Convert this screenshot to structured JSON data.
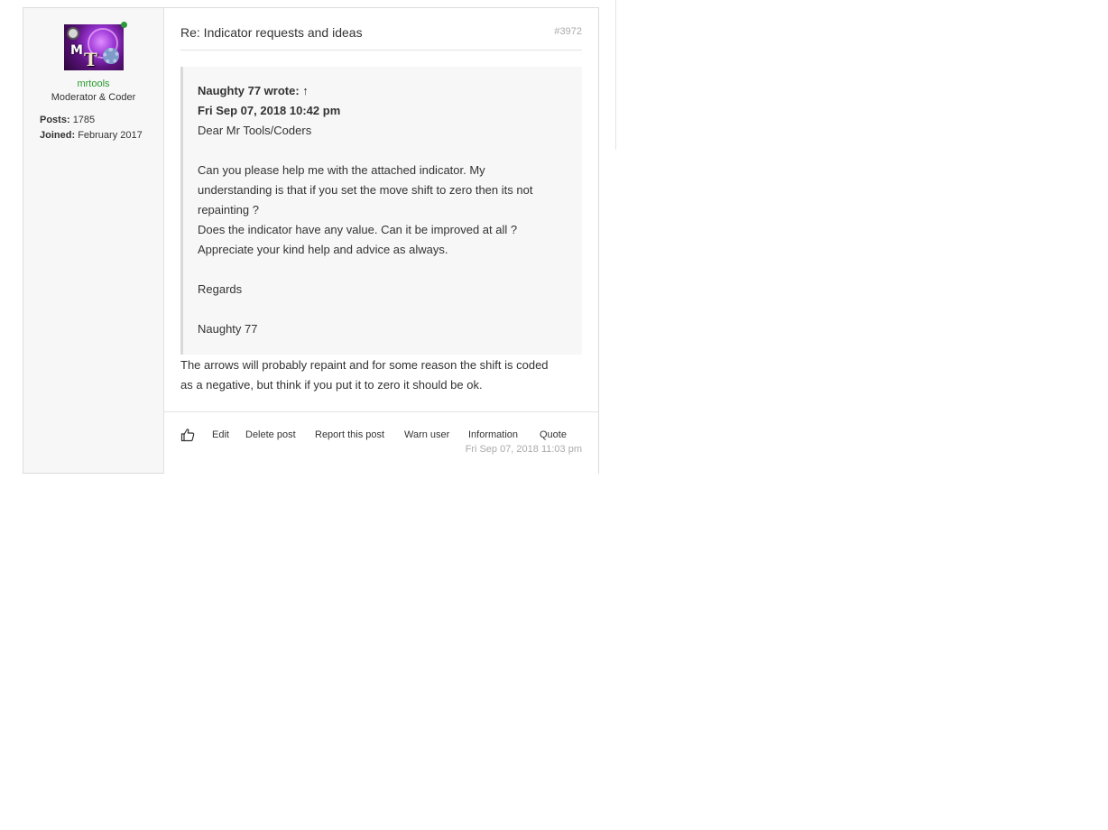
{
  "author": {
    "username": "mrtools",
    "rank": "Moderator & Coder",
    "posts_label": "Posts:",
    "posts_value": "1785",
    "joined_label": "Joined:",
    "joined_value": "February 2017",
    "online": true
  },
  "post": {
    "title": "Re: Indicator requests and ideas",
    "number": "#3972",
    "quote": {
      "author_line": "Naughty 77 wrote: ↑",
      "date_line": "Fri Sep 07, 2018 10:42 pm",
      "lines": [
        "Dear Mr Tools/Coders",
        "",
        "Can you please help me with the attached indicator. My",
        "understanding is that if you set the move shift to zero then its not",
        "repainting ?",
        "Does the indicator have any value. Can it be improved at all ?",
        "Appreciate your kind help and advice as always.",
        "",
        "Regards",
        "",
        "Naughty 77"
      ]
    },
    "reply_lines": [
      "The arrows will probably repaint and for some reason the shift is coded",
      "as a negative, but think if you put it to zero it should be ok."
    ],
    "date": "Fri Sep 07, 2018 11:03 pm"
  },
  "actions": {
    "like_icon": "thumbs-up-icon",
    "edit": "Edit",
    "delete": "Delete post",
    "report": "Report this post",
    "warn": "Warn user",
    "info": "Information",
    "quote": "Quote"
  }
}
